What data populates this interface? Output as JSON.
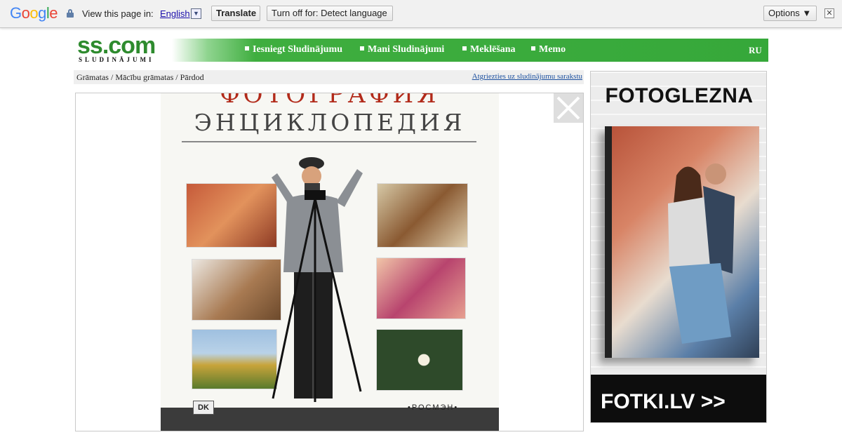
{
  "translate_bar": {
    "logo": [
      "G",
      "o",
      "o",
      "g",
      "l",
      "e"
    ],
    "view_label": "View this page in:",
    "language": "English",
    "translate_button": "Translate",
    "turn_off_button": "Turn off for: Detect language",
    "options_button": "Options ▼",
    "close": "✕"
  },
  "site": {
    "brand": "ss.com",
    "brand_sub": "SLUDINĀJUMI",
    "nav": [
      {
        "label": "Iesniegt Sludinājumu"
      },
      {
        "label": "Mani Sludinājumi"
      },
      {
        "label": "Meklēšana"
      },
      {
        "label": "Memo"
      }
    ],
    "lang_switch": "RU"
  },
  "breadcrumb": {
    "path": "Grāmatas / Mācību grāmatas / Pārdod",
    "back_link": "Atgriezties uz sludinājumu sarakstu"
  },
  "photo": {
    "title_top": "ФОТОГРАФИЯ",
    "title": "ЭНЦИКЛОПЕДИЯ",
    "publisher_mark": "DK",
    "publisher": "•РОСМЭН•"
  },
  "ad": {
    "title": "FOTOGLEZNA",
    "footer": "FOTKI.LV >>"
  },
  "colors": {
    "brand_green": "#2e8b2e",
    "nav_green": "#36a83a",
    "link_blue": "#1a4e9e"
  }
}
